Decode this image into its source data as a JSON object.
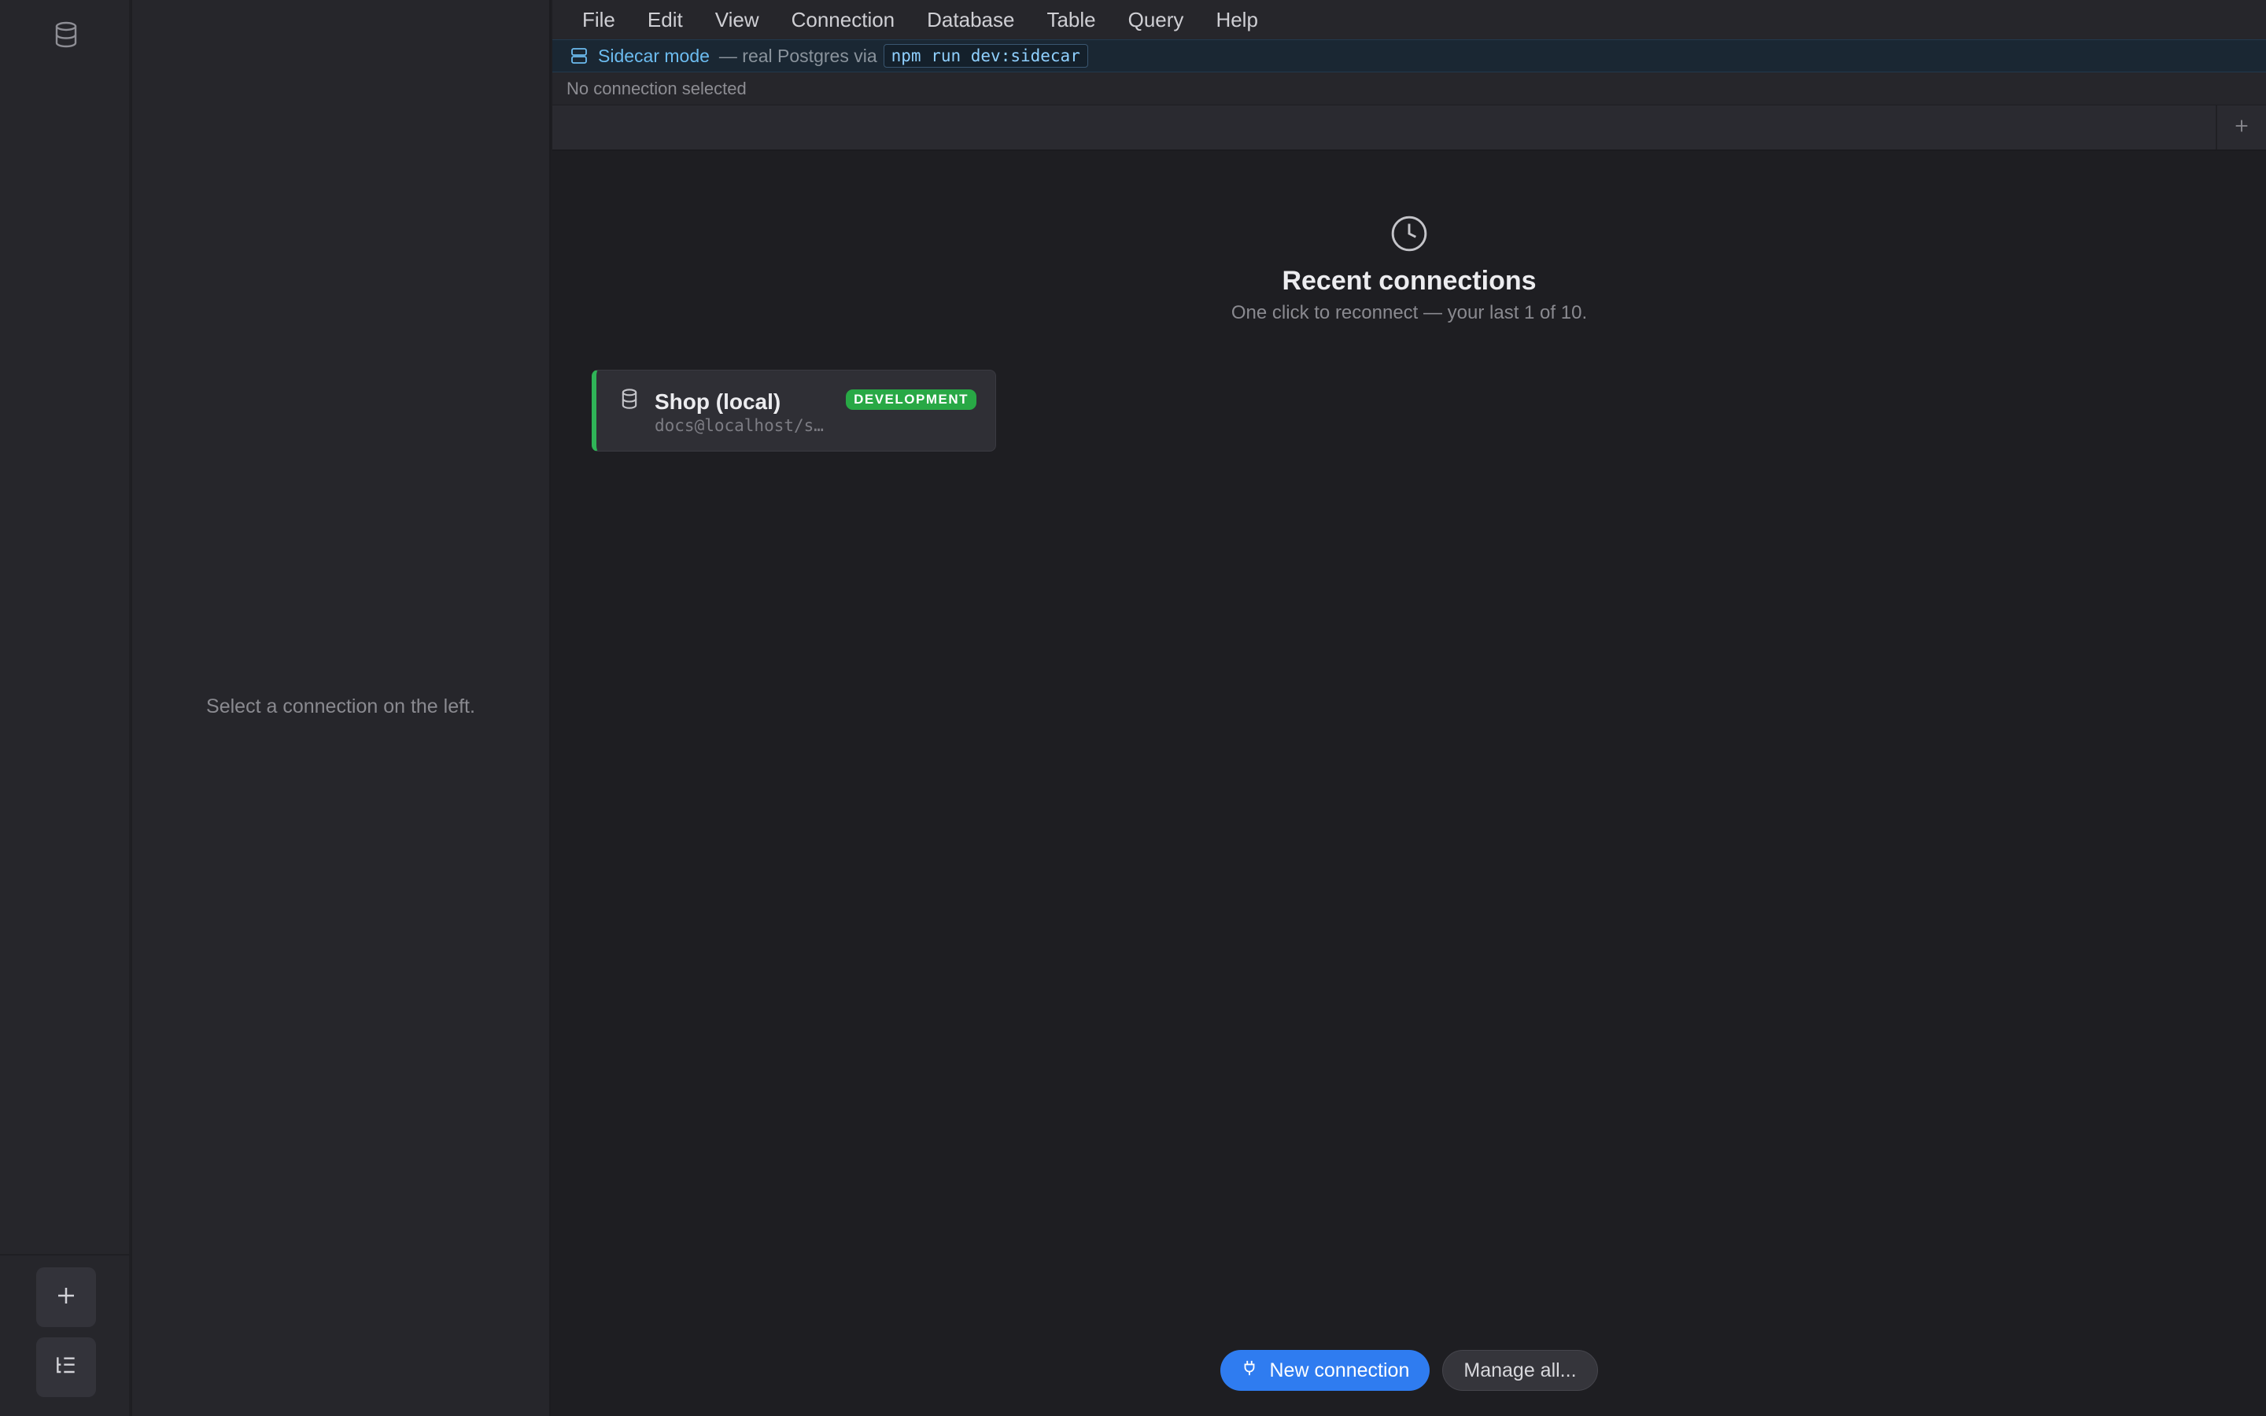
{
  "rail": {
    "top_icon": "database-icon",
    "add_icon": "plus-icon",
    "tree_icon": "tree-list-icon"
  },
  "panel": {
    "empty_text": "Select a connection on the left."
  },
  "menubar": {
    "items": [
      "File",
      "Edit",
      "View",
      "Connection",
      "Database",
      "Table",
      "Query",
      "Help"
    ]
  },
  "banner": {
    "icon": "server-icon",
    "title": "Sidecar mode",
    "text": "— real Postgres via",
    "command": "npm run dev:sidecar"
  },
  "status": {
    "text": "No connection selected"
  },
  "tabbar": {
    "add_label": "+"
  },
  "recent": {
    "icon": "clock-icon",
    "title": "Recent connections",
    "subtitle": "One click to reconnect — your last 1 of 10.",
    "connections": [
      {
        "name": "Shop (local)",
        "badge": "DEVELOPMENT",
        "host": "docs@localhost/s…",
        "accent": "#2fb457"
      }
    ]
  },
  "actions": {
    "new_connection": "New connection",
    "new_connection_icon": "plug-icon",
    "manage_all": "Manage all..."
  },
  "colors": {
    "accent": "#2f7cf0",
    "development": "#28a845",
    "sidecar": "#6cbcf0"
  }
}
